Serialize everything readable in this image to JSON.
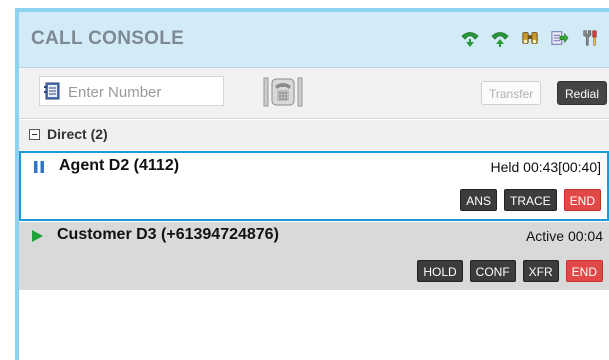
{
  "header": {
    "title": "CALL CONSOLE",
    "icons": [
      "phone-up-icon",
      "phone-down-icon",
      "binoculars-icon",
      "export-icon",
      "tools-icon"
    ]
  },
  "toolbar": {
    "number_placeholder": "Enter Number",
    "transfer_label": "Transfer",
    "redial_label": "Redial"
  },
  "group": {
    "label": "Direct (2)",
    "collapsed": false
  },
  "calls": [
    {
      "name": "Agent D2 (4112)",
      "status": "Held 00:43[00:40]",
      "state": "held",
      "actions": [
        "ANS",
        "TRACE",
        "END"
      ]
    },
    {
      "name": "Customer D3 (+61394724876)",
      "status": "Active 00:04",
      "state": "active",
      "actions": [
        "HOLD",
        "CONF",
        "XFR",
        "END"
      ]
    }
  ],
  "colors": {
    "accent": "#1d9ad6",
    "header_bg": "#d3ebf7",
    "end_red": "#e34848",
    "play_green": "#1fa23a"
  }
}
